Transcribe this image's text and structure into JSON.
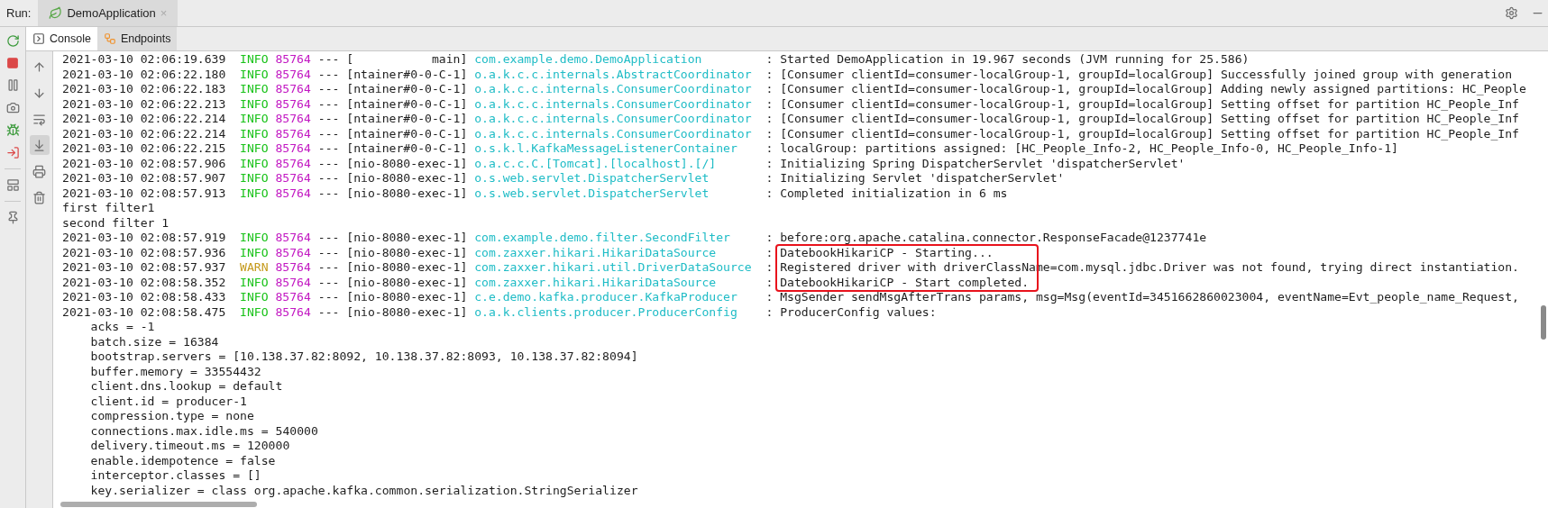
{
  "run_bar": {
    "label": "Run:",
    "tabs": [
      {
        "label": "DemoApplication",
        "selected": true,
        "close": "×"
      }
    ]
  },
  "tool_tabs": [
    {
      "kind": "console",
      "label": "Console",
      "selected": true
    },
    {
      "kind": "endpoints",
      "label": "Endpoints",
      "selected": false
    }
  ],
  "console_toolbar": [
    {
      "kind": "up",
      "selected": false
    },
    {
      "kind": "down",
      "selected": false
    },
    {
      "kind": "wrap",
      "selected": false
    },
    {
      "kind": "scroll_end",
      "selected": true
    },
    {
      "kind": "print",
      "selected": false
    },
    {
      "kind": "clear",
      "selected": false
    }
  ],
  "lines": [
    {
      "kind": "log",
      "time": "2021-03-10 02:06:19.639",
      "level": "INFO",
      "color": "#19c219",
      "pid": "85764",
      "sep": "---",
      "thread": "[           main]",
      "logger": "com.example.demo.DemoApplication",
      "message": ": Started DemoApplication in 19.967 seconds (JVM running for 25.586)"
    },
    {
      "kind": "log",
      "time": "2021-03-10 02:06:22.180",
      "level": "INFO",
      "color": "#19c219",
      "pid": "85764",
      "sep": "---",
      "thread": "[ntainer#0-0-C-1]",
      "logger": "o.a.k.c.c.internals.AbstractCoordinator",
      "message": ": [Consumer clientId=consumer-localGroup-1, groupId=localGroup] Successfully joined group with generation"
    },
    {
      "kind": "log",
      "time": "2021-03-10 02:06:22.183",
      "level": "INFO",
      "color": "#19c219",
      "pid": "85764",
      "sep": "---",
      "thread": "[ntainer#0-0-C-1]",
      "logger": "o.a.k.c.c.internals.ConsumerCoordinator",
      "message": ": [Consumer clientId=consumer-localGroup-1, groupId=localGroup] Adding newly assigned partitions: HC_People"
    },
    {
      "kind": "log",
      "time": "2021-03-10 02:06:22.213",
      "level": "INFO",
      "color": "#19c219",
      "pid": "85764",
      "sep": "---",
      "thread": "[ntainer#0-0-C-1]",
      "logger": "o.a.k.c.c.internals.ConsumerCoordinator",
      "message": ": [Consumer clientId=consumer-localGroup-1, groupId=localGroup] Setting offset for partition HC_People_Inf"
    },
    {
      "kind": "log",
      "time": "2021-03-10 02:06:22.214",
      "level": "INFO",
      "color": "#19c219",
      "pid": "85764",
      "sep": "---",
      "thread": "[ntainer#0-0-C-1]",
      "logger": "o.a.k.c.c.internals.ConsumerCoordinator",
      "message": ": [Consumer clientId=consumer-localGroup-1, groupId=localGroup] Setting offset for partition HC_People_Inf"
    },
    {
      "kind": "log",
      "time": "2021-03-10 02:06:22.214",
      "level": "INFO",
      "color": "#19c219",
      "pid": "85764",
      "sep": "---",
      "thread": "[ntainer#0-0-C-1]",
      "logger": "o.a.k.c.c.internals.ConsumerCoordinator",
      "message": ": [Consumer clientId=consumer-localGroup-1, groupId=localGroup] Setting offset for partition HC_People_Inf"
    },
    {
      "kind": "log",
      "time": "2021-03-10 02:06:22.215",
      "level": "INFO",
      "color": "#19c219",
      "pid": "85764",
      "sep": "---",
      "thread": "[ntainer#0-0-C-1]",
      "logger": "o.s.k.l.KafkaMessageListenerContainer",
      "message": ": localGroup: partitions assigned: [HC_People_Info-2, HC_People_Info-0, HC_People_Info-1]"
    },
    {
      "kind": "log",
      "time": "2021-03-10 02:08:57.906",
      "level": "INFO",
      "color": "#19c219",
      "pid": "85764",
      "sep": "---",
      "thread": "[nio-8080-exec-1]",
      "logger": "o.a.c.c.C.[Tomcat].[localhost].[/]",
      "message": ": Initializing Spring DispatcherServlet 'dispatcherServlet'"
    },
    {
      "kind": "log",
      "time": "2021-03-10 02:08:57.907",
      "level": "INFO",
      "color": "#19c219",
      "pid": "85764",
      "sep": "---",
      "thread": "[nio-8080-exec-1]",
      "logger": "o.s.web.servlet.DispatcherServlet",
      "message": ": Initializing Servlet 'dispatcherServlet'"
    },
    {
      "kind": "log",
      "time": "2021-03-10 02:08:57.913",
      "level": "INFO",
      "color": "#19c219",
      "pid": "85764",
      "sep": "---",
      "thread": "[nio-8080-exec-1]",
      "logger": "o.s.web.servlet.DispatcherServlet",
      "message": ": Completed initialization in 6 ms"
    },
    {
      "kind": "plain",
      "text": "first filter1"
    },
    {
      "kind": "plain",
      "text": "second filter 1"
    },
    {
      "kind": "log",
      "time": "2021-03-10 02:08:57.919",
      "level": "INFO",
      "color": "#19c219",
      "pid": "85764",
      "sep": "---",
      "thread": "[nio-8080-exec-1]",
      "logger": "com.example.demo.filter.SecondFilter",
      "message": ": before:org.apache.catalina.connector.ResponseFacade@1237741e"
    },
    {
      "kind": "boxed",
      "lines": [
        {
          "kind": "log",
          "time": "2021-03-10 02:08:57.936",
          "level": "INFO",
          "color": "#19c219",
          "pid": "85764",
          "sep": "---",
          "thread": "[nio-8080-exec-1]",
          "logger": "com.zaxxer.hikari.HikariDataSource",
          "message": ": DatebookHikariCP - Starting..."
        },
        {
          "kind": "log",
          "time": "2021-03-10 02:08:57.937",
          "level": "WARN",
          "color": "#c59a1c",
          "pid": "85764",
          "sep": "---",
          "thread": "[nio-8080-exec-1]",
          "logger": "com.zaxxer.hikari.util.DriverDataSource",
          "message": ": Registered driver with driverClassName=com.mysql.jdbc.Driver was not found, trying direct instantiation."
        },
        {
          "kind": "log",
          "time": "2021-03-10 02:08:58.352",
          "level": "INFO",
          "color": "#19c219",
          "pid": "85764",
          "sep": "---",
          "thread": "[nio-8080-exec-1]",
          "logger": "com.zaxxer.hikari.HikariDataSource",
          "message": ": DatebookHikariCP - Start completed."
        }
      ]
    },
    {
      "kind": "log",
      "time": "2021-03-10 02:08:58.433",
      "level": "INFO",
      "color": "#19c219",
      "pid": "85764",
      "sep": "---",
      "thread": "[nio-8080-exec-1]",
      "logger": "c.e.demo.kafka.producer.KafkaProducer",
      "message": ": MsgSender sendMsgAfterTrans params, msg=Msg(eventId=3451662860023004, eventName=Evt_people_name_Request,"
    },
    {
      "kind": "log",
      "time": "2021-03-10 02:08:58.475",
      "level": "INFO",
      "color": "#19c219",
      "pid": "85764",
      "sep": "---",
      "thread": "[nio-8080-exec-1]",
      "logger": "o.a.k.clients.producer.ProducerConfig",
      "message": ": ProducerConfig values:"
    },
    {
      "kind": "config",
      "text": "acks = -1"
    },
    {
      "kind": "config",
      "text": "batch.size = 16384"
    },
    {
      "kind": "config",
      "text": "bootstrap.servers = [10.138.37.82:8092, 10.138.37.82:8093, 10.138.37.82:8094]"
    },
    {
      "kind": "config",
      "text": "buffer.memory = 33554432"
    },
    {
      "kind": "config",
      "text": "client.dns.lookup = default"
    },
    {
      "kind": "config",
      "text": "client.id = producer-1"
    },
    {
      "kind": "config",
      "text": "compression.type = none"
    },
    {
      "kind": "config",
      "text": "connections.max.idle.ms = 540000"
    },
    {
      "kind": "config",
      "text": "delivery.timeout.ms = 120000"
    },
    {
      "kind": "config",
      "text": "enable.idempotence = false"
    },
    {
      "kind": "config",
      "text": "interceptor.classes = []"
    },
    {
      "kind": "config",
      "text": "key.serializer = class org.apache.kafka.common.serialization.StringSerializer"
    }
  ]
}
